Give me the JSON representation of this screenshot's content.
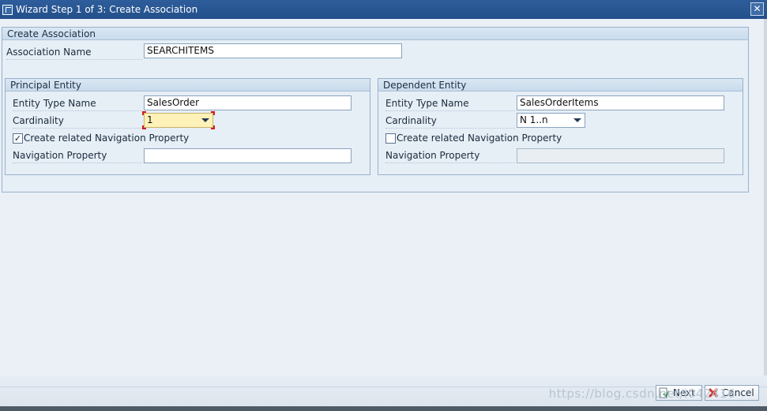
{
  "window": {
    "title": "Wizard Step 1 of 3: Create Association",
    "close_glyph": "✕"
  },
  "association": {
    "group_title": "Create Association",
    "name_label": "Association Name",
    "name_value": "SEARCHITEMS"
  },
  "principal": {
    "group_title": "Principal Entity",
    "entity_type_label": "Entity Type Name",
    "entity_type_value": "SalesOrder",
    "cardinality_label": "Cardinality",
    "cardinality_value": "1",
    "nav_checkbox_label": "Create related Navigation Property",
    "nav_checked": true,
    "nav_property_label": "Navigation Property",
    "nav_property_value": ""
  },
  "dependent": {
    "group_title": "Dependent Entity",
    "entity_type_label": "Entity Type Name",
    "entity_type_value": "SalesOrderItems",
    "cardinality_label": "Cardinality",
    "cardinality_value": "N 1..n",
    "nav_checkbox_label": "Create related Navigation Property",
    "nav_checked": false,
    "nav_property_label": "Navigation Property",
    "nav_property_value": ""
  },
  "footer": {
    "next_label": "Next",
    "cancel_label": "Cancel",
    "watermark": "https://blog.csdn.net/i042416"
  },
  "colors": {
    "titlebar": "#2e5d9b",
    "focus_field": "#fff2b8",
    "cancel_icon": "#d0342c",
    "next_icon": "#2e8a3a"
  }
}
